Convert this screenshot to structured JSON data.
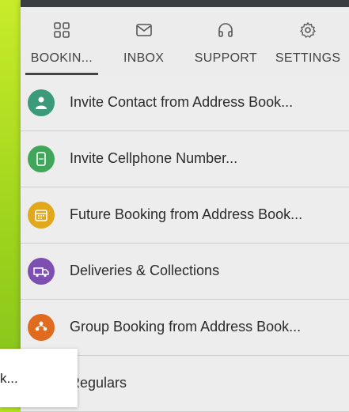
{
  "tabs": [
    {
      "label": "BOOKIN...",
      "icon": "grid-icon"
    },
    {
      "label": "INBOX",
      "icon": "mail-icon"
    },
    {
      "label": "SUPPORT",
      "icon": "headphones-icon"
    },
    {
      "label": "SETTINGS",
      "icon": "gear-icon"
    }
  ],
  "active_tab": "BOOKIN...",
  "menu": [
    {
      "label": "Invite Contact from Address Book...",
      "icon": "contact-icon",
      "color": "#3a9a7a"
    },
    {
      "label": "Invite Cellphone Number...",
      "icon": "phone-icon",
      "color": "#3fa65a"
    },
    {
      "label": "Future Booking from Address Book...",
      "icon": "calendar-icon",
      "color": "#e0a81a"
    },
    {
      "label": "Deliveries & Collections",
      "icon": "delivery-truck-icon",
      "color": "#7d4fb0"
    },
    {
      "label": "Group Booking from Address Book...",
      "icon": "group-icon",
      "color": "#e06a1e"
    },
    {
      "label": "Regulars",
      "icon": "",
      "color": ""
    }
  ],
  "overlay_text": "k...",
  "accent_colors": {
    "background": "#9bd21c",
    "panel": "#ececec",
    "header_bar": "#3a3e42"
  }
}
